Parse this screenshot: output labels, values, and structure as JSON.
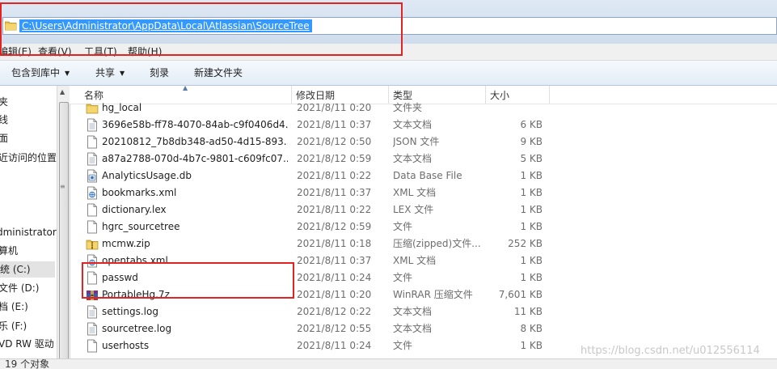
{
  "address": {
    "path": "C:\\Users\\Administrator\\AppData\\Local\\Atlassian\\SourceTree"
  },
  "menu": {
    "items": [
      "编辑(E)",
      "查看(V)",
      "工具(T)",
      "帮助(H)"
    ]
  },
  "toolbar": {
    "include_library": "包含到库中",
    "share": "共享",
    "burn": "刻录",
    "new_folder": "新建文件夹"
  },
  "nav": {
    "items": [
      "夹",
      "线",
      "面",
      "近访问的位置",
      "dministrator",
      "算机",
      "统 (C:)",
      "文件 (D:)",
      "档 (E:)",
      "乐 (F:)",
      "VD RW 驱动"
    ]
  },
  "columns": {
    "name": "名称",
    "date": "修改日期",
    "type": "类型",
    "size": "大小"
  },
  "files": [
    {
      "name": "hg_local",
      "date": "2021/8/11 0:20",
      "type": "文件夹",
      "size": "",
      "icon": "folder-icon"
    },
    {
      "name": "3696e58b-ff78-4070-84ab-c9f0406d4...",
      "date": "2021/8/11 0:37",
      "type": "文本文档",
      "size": "6 KB",
      "icon": "text-file-icon"
    },
    {
      "name": "20210812_7b8db348-ad50-4d15-893...",
      "date": "2021/8/12 0:50",
      "type": "JSON 文件",
      "size": "9 KB",
      "icon": "blank-file-icon"
    },
    {
      "name": "a87a2788-070d-4b7c-9801-c609fc07...",
      "date": "2021/8/12 0:59",
      "type": "文本文档",
      "size": "5 KB",
      "icon": "text-file-icon"
    },
    {
      "name": "AnalyticsUsage.db",
      "date": "2021/8/11 0:22",
      "type": "Data Base File",
      "size": "1 KB",
      "icon": "database-file-icon"
    },
    {
      "name": "bookmarks.xml",
      "date": "2021/8/11 0:37",
      "type": "XML 文档",
      "size": "1 KB",
      "icon": "xml-file-icon"
    },
    {
      "name": "dictionary.lex",
      "date": "2021/8/11 0:22",
      "type": "LEX 文件",
      "size": "1 KB",
      "icon": "blank-file-icon"
    },
    {
      "name": "hgrc_sourcetree",
      "date": "2021/8/12 0:59",
      "type": "文件",
      "size": "1 KB",
      "icon": "blank-file-icon"
    },
    {
      "name": "mcmw.zip",
      "date": "2021/8/11 0:18",
      "type": "压缩(zipped)文件...",
      "size": "252 KB",
      "icon": "zip-file-icon"
    },
    {
      "name": "opentabs.xml",
      "date": "2021/8/11 0:37",
      "type": "XML 文档",
      "size": "1 KB",
      "icon": "xml-file-icon"
    },
    {
      "name": "passwd",
      "date": "2021/8/11 0:24",
      "type": "文件",
      "size": "1 KB",
      "icon": "blank-file-icon"
    },
    {
      "name": "PortableHg.7z",
      "date": "2021/8/11 0:20",
      "type": "WinRAR 压缩文件",
      "size": "7,601 KB",
      "icon": "winrar-file-icon"
    },
    {
      "name": "settings.log",
      "date": "2021/8/12 0:22",
      "type": "文本文档",
      "size": "11 KB",
      "icon": "text-file-icon"
    },
    {
      "name": "sourcetree.log",
      "date": "2021/8/12 0:55",
      "type": "文本文档",
      "size": "8 KB",
      "icon": "text-file-icon"
    },
    {
      "name": "userhosts",
      "date": "2021/8/11 0:24",
      "type": "文件",
      "size": "1 KB",
      "icon": "blank-file-icon"
    }
  ],
  "status": {
    "count": "19 个对象"
  },
  "watermark": {
    "text": "https://blog.csdn.net/u012556114"
  },
  "colors": {
    "highlight_box": "#e32222",
    "selection": "#3399ff"
  }
}
